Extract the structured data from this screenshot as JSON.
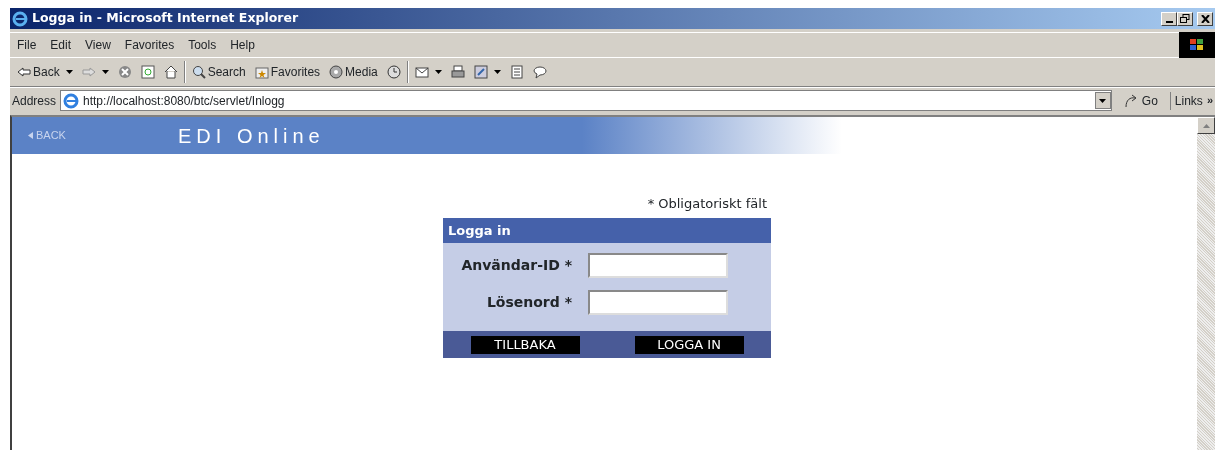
{
  "window": {
    "title": "Logga in - Microsoft Internet Explorer"
  },
  "menu": [
    "File",
    "Edit",
    "View",
    "Favorites",
    "Tools",
    "Help"
  ],
  "toolbar": [
    {
      "kind": "back",
      "label": "Back",
      "dropdown": true
    },
    {
      "kind": "forward",
      "dropdown": true
    },
    {
      "kind": "stop"
    },
    {
      "kind": "refresh"
    },
    {
      "kind": "home"
    },
    {
      "kind": "separator"
    },
    {
      "kind": "search",
      "label": "Search"
    },
    {
      "kind": "favorites",
      "label": "Favorites"
    },
    {
      "kind": "media",
      "label": "Media"
    },
    {
      "kind": "history"
    },
    {
      "kind": "separator"
    },
    {
      "kind": "mail",
      "dropdown": true
    },
    {
      "kind": "print"
    },
    {
      "kind": "edit",
      "dropdown": true
    },
    {
      "kind": "document"
    },
    {
      "kind": "discuss"
    }
  ],
  "address_bar": {
    "label": "Address",
    "url": "http://localhost:8080/btc/servlet/Inlogg",
    "go": "Go",
    "links": "Links",
    "links_more": "»"
  },
  "page": {
    "back_link": "BACK",
    "site_title": "EDI Online",
    "required_note": "* Obligatoriskt fält",
    "login": {
      "title": "Logga in",
      "fields": [
        {
          "label": "Användar-ID *"
        },
        {
          "label": "Lösenord *"
        }
      ],
      "buttons": [
        "TILLBAKA",
        "LOGGA IN"
      ]
    }
  }
}
